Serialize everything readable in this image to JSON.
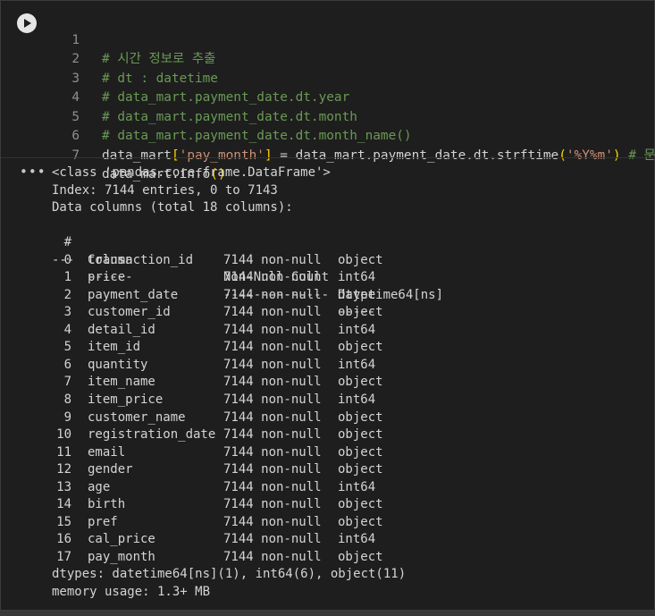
{
  "code_cell": {
    "lines": [
      {
        "num": "1",
        "comment": "# 시간 정보로 추출"
      },
      {
        "num": "2",
        "comment": "# dt : datetime"
      },
      {
        "num": "3",
        "comment": "# data_mart.payment_date.dt.year"
      },
      {
        "num": "4",
        "comment": "# data_mart.payment_date.dt.month"
      },
      {
        "num": "5",
        "comment": "# data_mart.payment_date.dt.month_name()"
      },
      {
        "num": "6",
        "pre": "data_mart",
        "b1": "[",
        "str1": "'pay_month'",
        "b2": "]",
        "mid": " = data_mart.payment_date.dt.strftime",
        "p1": "(",
        "str2": "'%Y%m'",
        "p2": ")",
        "comment": " # 문자열"
      },
      {
        "num": "7",
        "pre": "data_mart.info",
        "p": "()"
      }
    ]
  },
  "output": {
    "menu_label": "•••",
    "header": [
      "<class 'pandas.core.frame.DataFrame'>",
      "Index: 7144 entries, 0 to 7143",
      "Data columns (total 18 columns):"
    ],
    "columns_header": {
      "idx": "#",
      "name": "Column",
      "count": "Non-Null Count",
      "dtype": "Dtype"
    },
    "columns_rule": {
      "idx": "---",
      "name": "------",
      "count": "--------------",
      "dtype": "-----"
    },
    "rows": [
      {
        "idx": "0",
        "name": "transaction_id",
        "count": "7144 non-null",
        "dtype": "object"
      },
      {
        "idx": "1",
        "name": "price",
        "count": "7144 non-null",
        "dtype": "int64"
      },
      {
        "idx": "2",
        "name": "payment_date",
        "count": "7144 non-null",
        "dtype": "datetime64[ns]"
      },
      {
        "idx": "3",
        "name": "customer_id",
        "count": "7144 non-null",
        "dtype": "object"
      },
      {
        "idx": "4",
        "name": "detail_id",
        "count": "7144 non-null",
        "dtype": "int64"
      },
      {
        "idx": "5",
        "name": "item_id",
        "count": "7144 non-null",
        "dtype": "object"
      },
      {
        "idx": "6",
        "name": "quantity",
        "count": "7144 non-null",
        "dtype": "int64"
      },
      {
        "idx": "7",
        "name": "item_name",
        "count": "7144 non-null",
        "dtype": "object"
      },
      {
        "idx": "8",
        "name": "item_price",
        "count": "7144 non-null",
        "dtype": "int64"
      },
      {
        "idx": "9",
        "name": "customer_name",
        "count": "7144 non-null",
        "dtype": "object"
      },
      {
        "idx": "10",
        "name": "registration_date",
        "count": "7144 non-null",
        "dtype": "object"
      },
      {
        "idx": "11",
        "name": "email",
        "count": "7144 non-null",
        "dtype": "object"
      },
      {
        "idx": "12",
        "name": "gender",
        "count": "7144 non-null",
        "dtype": "object"
      },
      {
        "idx": "13",
        "name": "age",
        "count": "7144 non-null",
        "dtype": "int64"
      },
      {
        "idx": "14",
        "name": "birth",
        "count": "7144 non-null",
        "dtype": "object"
      },
      {
        "idx": "15",
        "name": "pref",
        "count": "7144 non-null",
        "dtype": "object"
      },
      {
        "idx": "16",
        "name": "cal_price",
        "count": "7144 non-null",
        "dtype": "int64"
      },
      {
        "idx": "17",
        "name": "pay_month",
        "count": "7144 non-null",
        "dtype": "object"
      }
    ],
    "footer": [
      "dtypes: datetime64[ns](1), int64(6), object(11)",
      "memory usage: 1.3+ MB"
    ]
  },
  "colors": {
    "background": "#1e1e1e",
    "comment": "#6a9955",
    "string": "#ce9178",
    "bracket": "#ffd700",
    "text": "#d4d4d4"
  },
  "icons": {
    "run": "play-circle-icon",
    "output_menu": "more-horizontal-icon"
  }
}
